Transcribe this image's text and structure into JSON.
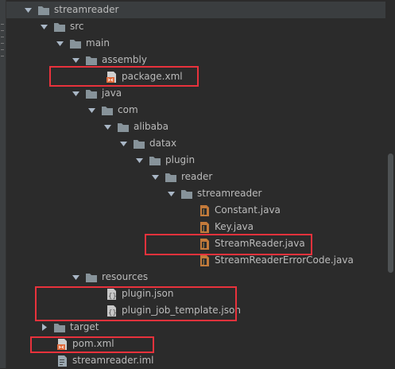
{
  "project_tree": {
    "items": [
      {
        "label": "streamreader",
        "type": "folder",
        "expanded": true
      },
      {
        "label": "src",
        "type": "folder",
        "expanded": true
      },
      {
        "label": "main",
        "type": "folder",
        "expanded": true
      },
      {
        "label": "assembly",
        "type": "folder",
        "expanded": true
      },
      {
        "label": "package.xml",
        "type": "xml-file"
      },
      {
        "label": "java",
        "type": "source-folder",
        "expanded": true
      },
      {
        "label": "com",
        "type": "folder",
        "expanded": true
      },
      {
        "label": "alibaba",
        "type": "folder",
        "expanded": true
      },
      {
        "label": "datax",
        "type": "folder",
        "expanded": true
      },
      {
        "label": "plugin",
        "type": "folder",
        "expanded": true
      },
      {
        "label": "reader",
        "type": "folder",
        "expanded": true
      },
      {
        "label": "streamreader",
        "type": "folder",
        "expanded": true
      },
      {
        "label": "Constant.java",
        "type": "java-file"
      },
      {
        "label": "Key.java",
        "type": "java-file"
      },
      {
        "label": "StreamReader.java",
        "type": "java-file"
      },
      {
        "label": "StreamReaderErrorCode.java",
        "type": "java-file"
      },
      {
        "label": "resources",
        "type": "resources-folder",
        "expanded": true
      },
      {
        "label": "plugin.json",
        "type": "json-file"
      },
      {
        "label": "plugin_job_template.json",
        "type": "json-file"
      },
      {
        "label": "target",
        "type": "excluded-folder",
        "expanded": false
      },
      {
        "label": "pom.xml",
        "type": "maven-file"
      },
      {
        "label": "streamreader.iml",
        "type": "iml-file"
      }
    ]
  },
  "colors": {
    "background": "#2b2b2b",
    "text": "#bbbbbb",
    "folder": "#87939a",
    "folder_target": "#c58c3c",
    "java_file": "#c37a3a",
    "xml_icon": "#e06b3c",
    "highlight_box": "#e8323c"
  }
}
